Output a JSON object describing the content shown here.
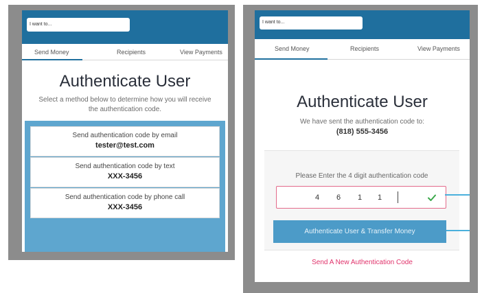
{
  "search": {
    "placeholder": "I want to..."
  },
  "tabs": [
    "Send Money",
    "Recipients",
    "View Payments"
  ],
  "left": {
    "title": "Authenticate User",
    "subtitle": "Select a method below to determine how you will receive the authentication code.",
    "options": [
      {
        "label": "Send authentication code by email",
        "value": "tester@test.com"
      },
      {
        "label": "Send authentication code by text",
        "value": "XXX-3456"
      },
      {
        "label": "Send authentication code by phone call",
        "value": "XXX-3456"
      }
    ]
  },
  "right": {
    "title": "Authenticate User",
    "sent_text": "We have sent the authentication code to:",
    "phone": "(818) 555-3456",
    "prompt": "Please Enter the 4 digit authentication code",
    "code_digits": [
      "4",
      "6",
      "1",
      "1"
    ],
    "submit_label": "Authenticate User & Transfer Money",
    "resend_label": "Send A New Authentication Code"
  },
  "colors": {
    "header": "#1f6f9e",
    "accent": "#4c9bc8",
    "highlight": "#5ea6cf",
    "error_pink": "#e0316a",
    "check_green": "#3aa84a"
  }
}
